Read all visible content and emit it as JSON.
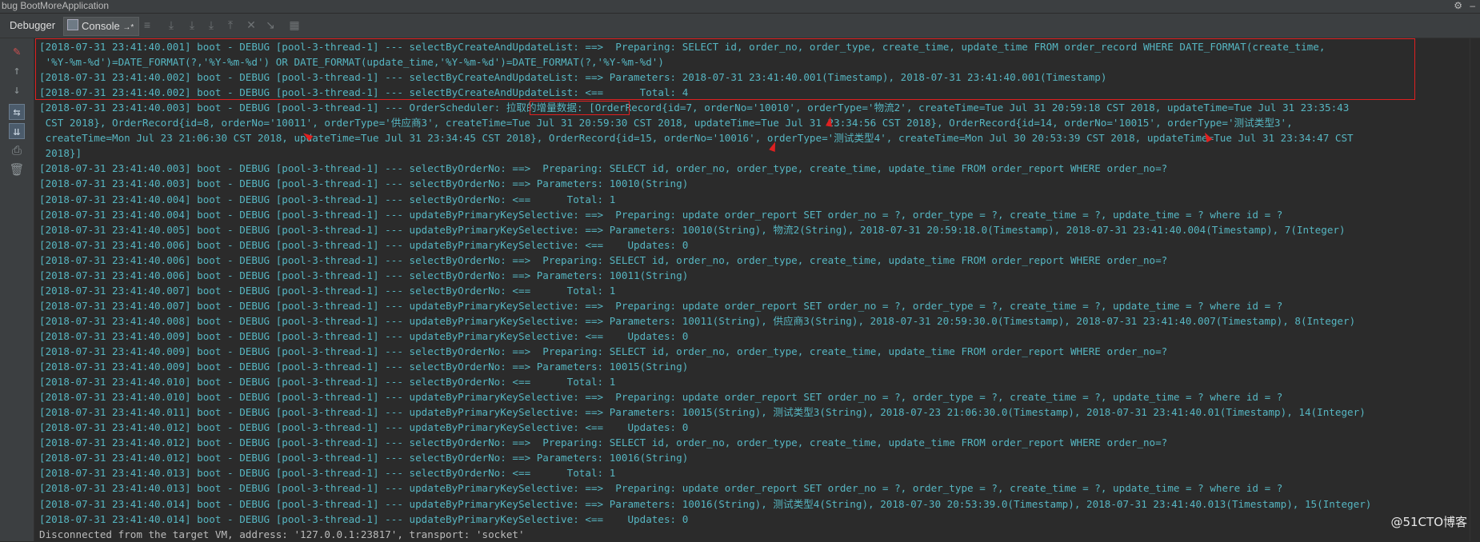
{
  "window": {
    "title": "bug  BootMoreApplication"
  },
  "tabs": {
    "debugger": "Debugger",
    "console": "Console",
    "console_pin": "→*"
  },
  "toolbar_icons": [
    "resume-icon",
    "step-over-icon",
    "step-into-icon",
    "force-step-into-icon",
    "step-out-icon",
    "drop-frame-icon",
    "run-to-cursor-icon",
    "evaluate-icon"
  ],
  "left_tools": [
    "clear-icon",
    "up-arrow-icon",
    "down-arrow-icon",
    "soft-wrap-icon",
    "scroll-to-end-icon",
    "print-icon",
    "trash-icon"
  ],
  "console": {
    "lines": [
      "[2018-07-31 23:41:40.001] boot - DEBUG [pool-3-thread-1] --- selectByCreateAndUpdateList: ==>  Preparing: SELECT id, order_no, order_type, create_time, update_time FROM order_record WHERE DATE_FORMAT(create_time,",
      " '%Y-%m-%d')=DATE_FORMAT(?,'%Y-%m-%d') OR DATE_FORMAT(update_time,'%Y-%m-%d')=DATE_FORMAT(?,'%Y-%m-%d')",
      "[2018-07-31 23:41:40.002] boot - DEBUG [pool-3-thread-1] --- selectByCreateAndUpdateList: ==> Parameters: 2018-07-31 23:41:40.001(Timestamp), 2018-07-31 23:41:40.001(Timestamp)",
      "[2018-07-31 23:41:40.002] boot - DEBUG [pool-3-thread-1] --- selectByCreateAndUpdateList: <==      Total: 4",
      "[2018-07-31 23:41:40.003] boot - DEBUG [pool-3-thread-1] --- OrderScheduler: 拉取的增量数据: [OrderRecord{id=7, orderNo='10010', orderType='物流2', createTime=Tue Jul 31 20:59:18 CST 2018, updateTime=Tue Jul 31 23:35:43",
      " CST 2018}, OrderRecord{id=8, orderNo='10011', orderType='供应商3', createTime=Tue Jul 31 20:59:30 CST 2018, updateTime=Tue Jul 31 23:34:56 CST 2018}, OrderRecord{id=14, orderNo='10015', orderType='测试类型3',",
      " createTime=Mon Jul 23 21:06:30 CST 2018, updateTime=Tue Jul 31 23:34:45 CST 2018}, OrderRecord{id=15, orderNo='10016', orderType='测试类型4', createTime=Mon Jul 30 20:53:39 CST 2018, updateTime=Tue Jul 31 23:34:47 CST",
      " 2018}]",
      "[2018-07-31 23:41:40.003] boot - DEBUG [pool-3-thread-1] --- selectByOrderNo: ==>  Preparing: SELECT id, order_no, order_type, create_time, update_time FROM order_report WHERE order_no=?",
      "[2018-07-31 23:41:40.003] boot - DEBUG [pool-3-thread-1] --- selectByOrderNo: ==> Parameters: 10010(String)",
      "[2018-07-31 23:41:40.004] boot - DEBUG [pool-3-thread-1] --- selectByOrderNo: <==      Total: 1",
      "[2018-07-31 23:41:40.004] boot - DEBUG [pool-3-thread-1] --- updateByPrimaryKeySelective: ==>  Preparing: update order_report SET order_no = ?, order_type = ?, create_time = ?, update_time = ? where id = ?",
      "[2018-07-31 23:41:40.005] boot - DEBUG [pool-3-thread-1] --- updateByPrimaryKeySelective: ==> Parameters: 10010(String), 物流2(String), 2018-07-31 20:59:18.0(Timestamp), 2018-07-31 23:41:40.004(Timestamp), 7(Integer)",
      "[2018-07-31 23:41:40.006] boot - DEBUG [pool-3-thread-1] --- updateByPrimaryKeySelective: <==    Updates: 0",
      "[2018-07-31 23:41:40.006] boot - DEBUG [pool-3-thread-1] --- selectByOrderNo: ==>  Preparing: SELECT id, order_no, order_type, create_time, update_time FROM order_report WHERE order_no=?",
      "[2018-07-31 23:41:40.006] boot - DEBUG [pool-3-thread-1] --- selectByOrderNo: ==> Parameters: 10011(String)",
      "[2018-07-31 23:41:40.007] boot - DEBUG [pool-3-thread-1] --- selectByOrderNo: <==      Total: 1",
      "[2018-07-31 23:41:40.007] boot - DEBUG [pool-3-thread-1] --- updateByPrimaryKeySelective: ==>  Preparing: update order_report SET order_no = ?, order_type = ?, create_time = ?, update_time = ? where id = ?",
      "[2018-07-31 23:41:40.008] boot - DEBUG [pool-3-thread-1] --- updateByPrimaryKeySelective: ==> Parameters: 10011(String), 供应商3(String), 2018-07-31 20:59:30.0(Timestamp), 2018-07-31 23:41:40.007(Timestamp), 8(Integer)",
      "[2018-07-31 23:41:40.009] boot - DEBUG [pool-3-thread-1] --- updateByPrimaryKeySelective: <==    Updates: 0",
      "[2018-07-31 23:41:40.009] boot - DEBUG [pool-3-thread-1] --- selectByOrderNo: ==>  Preparing: SELECT id, order_no, order_type, create_time, update_time FROM order_report WHERE order_no=?",
      "[2018-07-31 23:41:40.009] boot - DEBUG [pool-3-thread-1] --- selectByOrderNo: ==> Parameters: 10015(String)",
      "[2018-07-31 23:41:40.010] boot - DEBUG [pool-3-thread-1] --- selectByOrderNo: <==      Total: 1",
      "[2018-07-31 23:41:40.010] boot - DEBUG [pool-3-thread-1] --- updateByPrimaryKeySelective: ==>  Preparing: update order_report SET order_no = ?, order_type = ?, create_time = ?, update_time = ? where id = ?",
      "[2018-07-31 23:41:40.011] boot - DEBUG [pool-3-thread-1] --- updateByPrimaryKeySelective: ==> Parameters: 10015(String), 测试类型3(String), 2018-07-23 21:06:30.0(Timestamp), 2018-07-31 23:41:40.01(Timestamp), 14(Integer)",
      "[2018-07-31 23:41:40.012] boot - DEBUG [pool-3-thread-1] --- updateByPrimaryKeySelective: <==    Updates: 0",
      "[2018-07-31 23:41:40.012] boot - DEBUG [pool-3-thread-1] --- selectByOrderNo: ==>  Preparing: SELECT id, order_no, order_type, create_time, update_time FROM order_report WHERE order_no=?",
      "[2018-07-31 23:41:40.012] boot - DEBUG [pool-3-thread-1] --- selectByOrderNo: ==> Parameters: 10016(String)",
      "[2018-07-31 23:41:40.013] boot - DEBUG [pool-3-thread-1] --- selectByOrderNo: <==      Total: 1",
      "[2018-07-31 23:41:40.013] boot - DEBUG [pool-3-thread-1] --- updateByPrimaryKeySelective: ==>  Preparing: update order_report SET order_no = ?, order_type = ?, create_time = ?, update_time = ? where id = ?",
      "[2018-07-31 23:41:40.014] boot - DEBUG [pool-3-thread-1] --- updateByPrimaryKeySelective: ==> Parameters: 10016(String), 测试类型4(String), 2018-07-30 20:53:39.0(Timestamp), 2018-07-31 23:41:40.013(Timestamp), 15(Integer)",
      "[2018-07-31 23:41:40.014] boot - DEBUG [pool-3-thread-1] --- updateByPrimaryKeySelective: <==    Updates: 0",
      "Disconnected from the target VM, address: '127.0.0.1:23817', transport: 'socket'"
    ]
  },
  "watermark": "@51CTO博客",
  "colors": {
    "log_text": "#56b6c2",
    "annotation": "#e02020",
    "background": "#2b2b2b"
  }
}
